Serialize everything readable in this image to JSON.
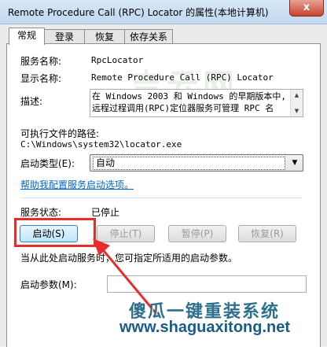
{
  "window": {
    "title": "Remote Procedure Call (RPC) Locator 的属性(本地计算机)",
    "close_label": "x"
  },
  "tabs": [
    {
      "label": "常规",
      "active": true
    },
    {
      "label": "登录",
      "active": false
    },
    {
      "label": "恢复",
      "active": false
    },
    {
      "label": "依存关系",
      "active": false
    }
  ],
  "general": {
    "service_name_label": "服务名称:",
    "service_name": "RpcLocator",
    "display_name_label": "显示名称:",
    "display_name": "Remote Procedure Call (RPC) Locator",
    "description_label": "描述:",
    "description": "在 Windows 2003 和 Windows 的早期版本中,远程过程调用(RPC)定位器服务可管理 RPC 名",
    "exe_path_label": "可执行文件的路径:",
    "exe_path": "C:\\Windows\\system32\\locator.exe",
    "startup_type_label": "启动类型(E):",
    "startup_type_value": "自动",
    "help_link": "帮助我配置服务启动选项。",
    "status_label": "服务状态:",
    "status_value": "已停止",
    "buttons": {
      "start": "启动(S)",
      "stop": "停止(T)",
      "pause": "暂停(P)",
      "resume": "恢复(R)"
    },
    "hint": "当从此处启动服务时，您可指定所适用的启动参数。",
    "start_params_label": "启动参数(M):",
    "start_params_value": ""
  },
  "watermark": {
    "brand": "傻瓜一键重装系统",
    "url": "www.shaguaxitong.net",
    "faint": "吉云网"
  },
  "colors": {
    "highlight_box": "#e82b2b",
    "link": "#0066cc",
    "watermark": "#1a5c86"
  }
}
